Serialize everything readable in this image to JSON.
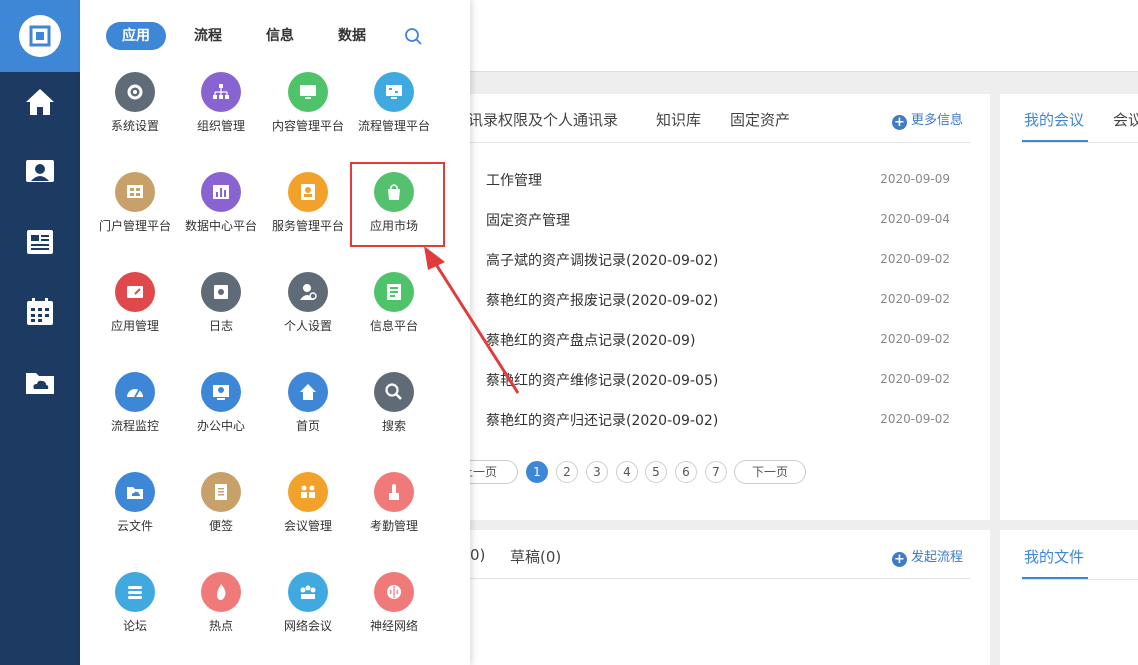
{
  "rail": {
    "items": [
      {
        "name": "home-icon"
      },
      {
        "name": "contact-icon"
      },
      {
        "name": "news-icon"
      },
      {
        "name": "calendar-icon"
      },
      {
        "name": "cloud-folder-icon"
      }
    ]
  },
  "menu": {
    "tabs": [
      {
        "label": "应用",
        "active": true
      },
      {
        "label": "流程",
        "active": false
      },
      {
        "label": "信息",
        "active": false
      },
      {
        "label": "数据",
        "active": false
      }
    ],
    "apps": [
      {
        "label": "系统设置",
        "color": "#5f6b77",
        "icon": "gear-icon"
      },
      {
        "label": "组织管理",
        "color": "#8a63d2",
        "icon": "org-chart-icon"
      },
      {
        "label": "内容管理平台",
        "color": "#4fc36a",
        "icon": "monitor-icon"
      },
      {
        "label": "流程管理平台",
        "color": "#3fa9e0",
        "icon": "flow-screen-icon"
      },
      {
        "label": "门户管理平台",
        "color": "#c8a06a",
        "icon": "portal-icon"
      },
      {
        "label": "数据中心平台",
        "color": "#8a63d2",
        "icon": "bar-chart-icon"
      },
      {
        "label": "服务管理平台",
        "color": "#f2a22a",
        "icon": "service-icon"
      },
      {
        "label": "应用市场",
        "color": "#55c06e",
        "icon": "shopping-bag-icon"
      },
      {
        "label": "应用管理",
        "color": "#e0484b",
        "icon": "app-manage-icon"
      },
      {
        "label": "日志",
        "color": "#5f6b77",
        "icon": "log-icon"
      },
      {
        "label": "个人设置",
        "color": "#5f6b77",
        "icon": "user-gear-icon"
      },
      {
        "label": "信息平台",
        "color": "#4fc36a",
        "icon": "info-screen-icon"
      },
      {
        "label": "流程监控",
        "color": "#3e86d6",
        "icon": "gauge-icon"
      },
      {
        "label": "办公中心",
        "color": "#3e86d6",
        "icon": "office-icon"
      },
      {
        "label": "首页",
        "color": "#3e86d6",
        "icon": "home-icon"
      },
      {
        "label": "搜索",
        "color": "#5f6b77",
        "icon": "search-icon"
      },
      {
        "label": "云文件",
        "color": "#3e86d6",
        "icon": "cloud-folder-icon"
      },
      {
        "label": "便签",
        "color": "#c8a06a",
        "icon": "note-icon"
      },
      {
        "label": "会议管理",
        "color": "#f2a22a",
        "icon": "meeting-icon"
      },
      {
        "label": "考勤管理",
        "color": "#f07a7a",
        "icon": "touch-icon"
      },
      {
        "label": "论坛",
        "color": "#3fa9e0",
        "icon": "forum-icon"
      },
      {
        "label": "热点",
        "color": "#f07a7a",
        "icon": "fire-icon"
      },
      {
        "label": "网络会议",
        "color": "#3fa9e0",
        "icon": "network-meeting-icon"
      },
      {
        "label": "神经网络",
        "color": "#f07a7a",
        "icon": "brain-icon"
      }
    ]
  },
  "main": {
    "card1": {
      "tabs": [
        "讯录权限及个人通讯录",
        "知识库",
        "固定资产"
      ],
      "more_label": "更多信息",
      "rows": [
        {
          "title": "工作管理",
          "date": "2020-09-09"
        },
        {
          "title": "固定资产管理",
          "date": "2020-09-04"
        },
        {
          "title": "高子斌的资产调拨记录(2020-09-02)",
          "date": "2020-09-02"
        },
        {
          "title": "蔡艳红的资产报废记录(2020-09-02)",
          "date": "2020-09-02"
        },
        {
          "title": "蔡艳红的资产盘点记录(2020-09)",
          "date": "2020-09-02"
        },
        {
          "title": "蔡艳红的资产维修记录(2020-09-05)",
          "date": "2020-09-02"
        },
        {
          "title": "蔡艳红的资产归还记录(2020-09-02)",
          "date": "2020-09-02"
        }
      ],
      "pager": {
        "prev": "上一页",
        "next": "下一页",
        "pages": [
          "1",
          "2",
          "3",
          "4",
          "5",
          "6",
          "7"
        ],
        "current": "1"
      }
    },
    "card2": {
      "tab_partial": "0)",
      "tab_draft": "草稿(0)",
      "action_label": "发起流程"
    },
    "right1": {
      "tab_active": "我的会议",
      "tab_partial": "会议"
    },
    "right2": {
      "tab_active": "我的文件"
    }
  },
  "colors": {
    "accent": "#3e86d6",
    "rail": "#1d3a63",
    "highlight": "#e23b3b"
  }
}
